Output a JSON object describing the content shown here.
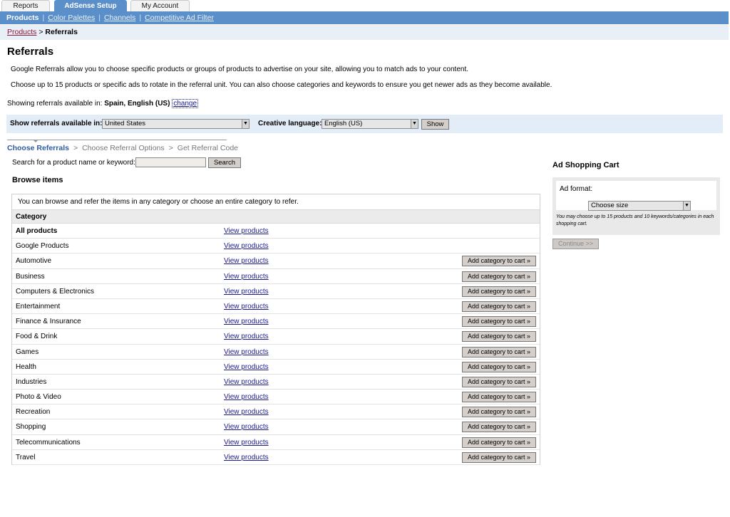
{
  "tabs": [
    {
      "label": "Reports"
    },
    {
      "label": "AdSense Setup"
    },
    {
      "label": "My Account"
    }
  ],
  "subnav": {
    "items": [
      "Products",
      "Color Palettes",
      "Channels",
      "Competitive Ad Filter"
    ]
  },
  "breadcrumb": {
    "parent": "Products",
    "sep": " > ",
    "current": "Referrals"
  },
  "page": {
    "title": "Referrals",
    "intro1": "Google Referrals allow you to choose specific products or groups of products to advertise on your site, allowing you to match ads to your content.",
    "intro2": "Choose up to 15 products or specific ads to rotate in the referral unit. You can also choose categories and keywords to ensure you get newer ads as they become available.",
    "showing_prefix": "Showing referrals available in: ",
    "showing_value": "Spain, English (US)",
    "change_link": "change"
  },
  "filter": {
    "country_label": "Show referrals available in:",
    "country_value": "United States",
    "language_label": "Creative language:",
    "language_value": "English (US)",
    "show_button": "Show"
  },
  "steps": {
    "step1": "Choose Referrals",
    "step2": "Choose Referral Options",
    "step3": "Get Referral Code",
    "gt": ">"
  },
  "search": {
    "label": "Search for a product name or keyword:",
    "value": "",
    "button": "Search"
  },
  "browse": {
    "heading": "Browse items",
    "intro": "You can browse and refer the items in any category or choose an entire category to refer.",
    "column_header": "Category",
    "view_label": "View products",
    "add_label": "Add category to cart »",
    "rows": [
      "All products",
      "Google Products",
      "Automotive",
      "Business",
      "Computers & Electronics",
      "Entertainment",
      "Finance & Insurance",
      "Food & Drink",
      "Games",
      "Health",
      "Industries",
      "Photo & Video",
      "Recreation",
      "Shopping",
      "Telecommunications",
      "Travel"
    ]
  },
  "cart": {
    "title": "Ad Shopping Cart",
    "format_label": "Ad format:",
    "format_value": "Choose size",
    "note": "You may choose up to 15 products and 10 keywords/categories in each shopping cart.",
    "continue_button": "Continue >>"
  },
  "colors": {
    "nav_blue": "#5b8fc9",
    "crumb_bg": "#e9eff7",
    "filter_bg": "#e3edf8",
    "link": "#1a1a8c"
  }
}
